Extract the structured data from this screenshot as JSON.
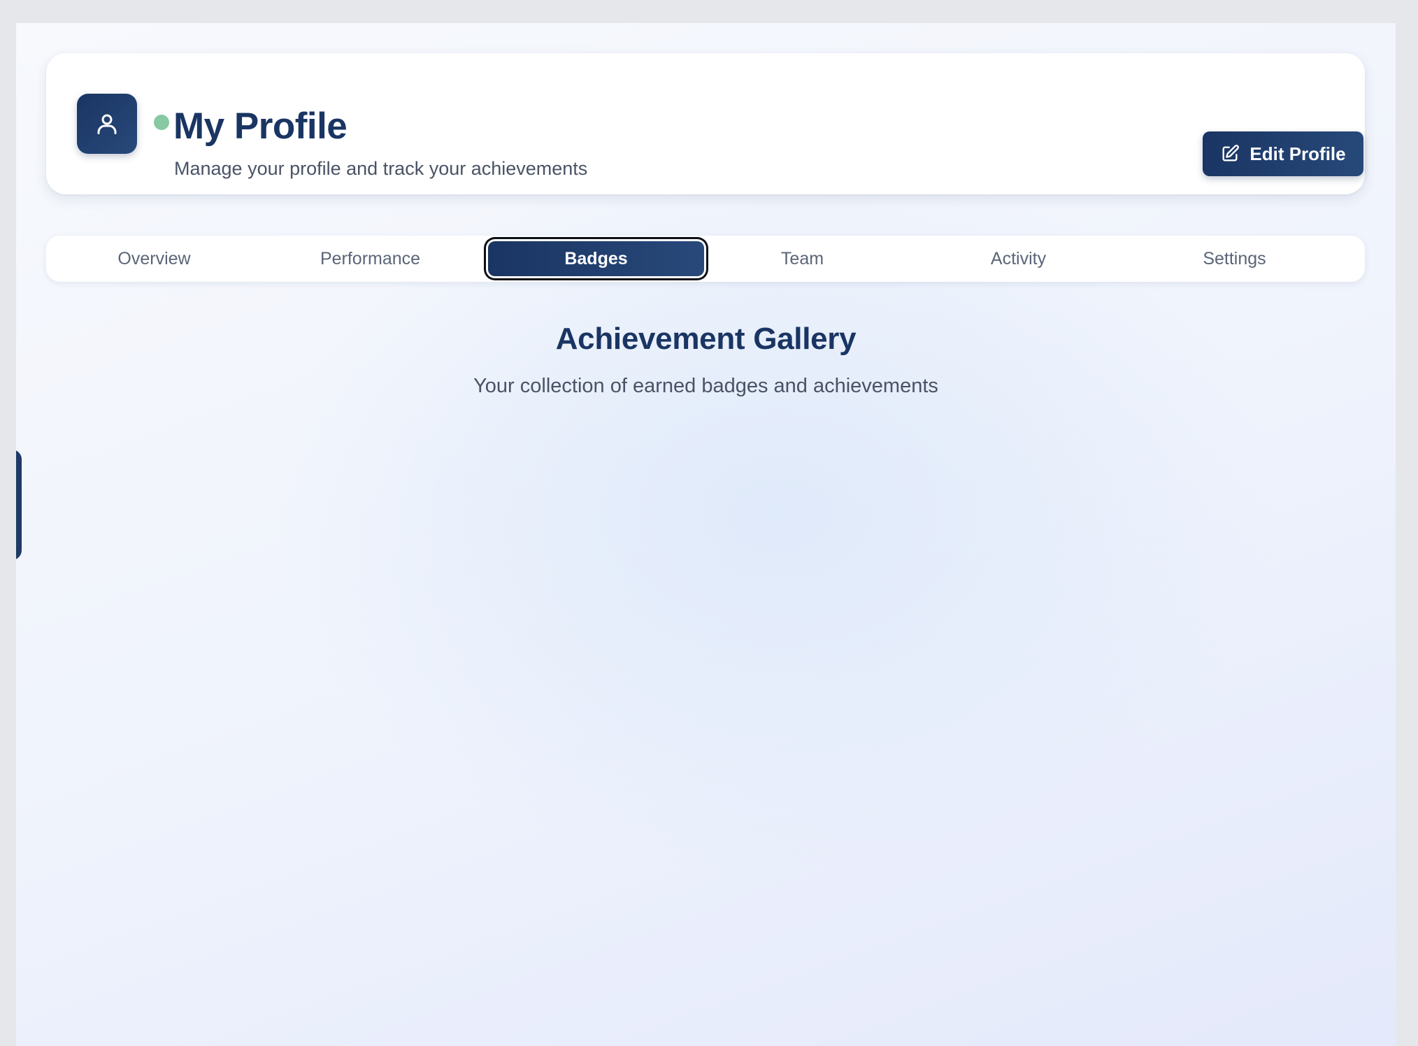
{
  "header": {
    "title": "My Profile",
    "subtitle": "Manage your profile and track your achievements",
    "avatar_icon": "user-icon",
    "status_color": "#86c9a3",
    "edit_button": {
      "label": "Edit Profile",
      "icon": "edit-icon"
    }
  },
  "tabs": [
    {
      "label": "Overview",
      "active": false
    },
    {
      "label": "Performance",
      "active": false
    },
    {
      "label": "Badges",
      "active": true
    },
    {
      "label": "Team",
      "active": false
    },
    {
      "label": "Activity",
      "active": false
    },
    {
      "label": "Settings",
      "active": false
    }
  ],
  "section": {
    "title": "Achievement Gallery",
    "subtitle": "Your collection of earned badges and achievements"
  },
  "colors": {
    "brand": "#1a3563",
    "text_muted": "#4a5365",
    "tab_text": "#5b6577"
  }
}
